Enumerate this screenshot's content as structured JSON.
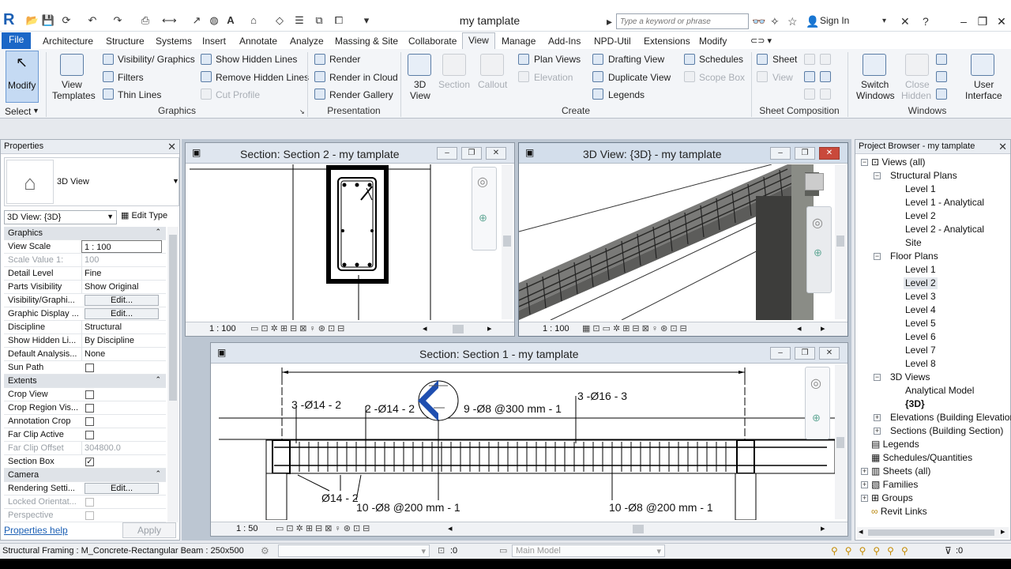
{
  "app": {
    "logo": "R",
    "title": "my tamplate"
  },
  "search": {
    "placeholder": "Type a keyword or phrase"
  },
  "signin": "Sign In",
  "tabs": [
    "File",
    "Architecture",
    "Structure",
    "Systems",
    "Insert",
    "Annotate",
    "Analyze",
    "Massing & Site",
    "Collaborate",
    "View",
    "Manage",
    "Add-Ins",
    "NPD-Util",
    "Extensions",
    "Modify"
  ],
  "ribbon": {
    "modify": "Modify",
    "select": "Select",
    "view_templates": [
      "View",
      "Templates"
    ],
    "graphics_items": [
      "Visibility/ Graphics",
      "Filters",
      "Thin Lines",
      "Show Hidden Lines",
      "Remove Hidden Lines",
      "Cut Profile"
    ],
    "graphics_title": "Graphics",
    "presentation_items": [
      "Render",
      "Render in Cloud",
      "Render Gallery"
    ],
    "presentation_title": "Presentation",
    "create_big": [
      "3D",
      "View",
      "Section",
      "Callout"
    ],
    "create_items": [
      "Plan Views",
      "Elevation",
      "Drafting View",
      "Duplicate View",
      "Legends",
      "Schedules",
      "Scope Box"
    ],
    "create_title": "Create",
    "sheet_items": [
      "Sheet",
      "View"
    ],
    "sheet_title": "Sheet Composition",
    "windows_items": [
      "Switch",
      "Windows",
      "Close",
      "Hidden",
      "User",
      "Interface"
    ],
    "windows_title": "Windows"
  },
  "properties": {
    "title": "Properties",
    "type_name": "3D View",
    "selector": "3D View: {3D}",
    "edit_type": "Edit Type",
    "sections": [
      "Graphics",
      "Extents",
      "Camera"
    ],
    "rows": [
      {
        "k": "View Scale",
        "v": "1 : 100"
      },
      {
        "k": "Scale Value    1:",
        "v": "100"
      },
      {
        "k": "Detail Level",
        "v": "Fine"
      },
      {
        "k": "Parts Visibility",
        "v": "Show Original"
      },
      {
        "k": "Visibility/Graphi...",
        "v": "Edit..."
      },
      {
        "k": "Graphic Display ...",
        "v": "Edit..."
      },
      {
        "k": "Discipline",
        "v": "Structural"
      },
      {
        "k": "Show Hidden Li...",
        "v": "By Discipline"
      },
      {
        "k": "Default Analysis...",
        "v": "None"
      },
      {
        "k": "Sun Path",
        "v": ""
      },
      {
        "k": "Crop View",
        "v": ""
      },
      {
        "k": "Crop Region Vis...",
        "v": ""
      },
      {
        "k": "Annotation Crop",
        "v": ""
      },
      {
        "k": "Far Clip Active",
        "v": ""
      },
      {
        "k": "Far Clip Offset",
        "v": "304800.0"
      },
      {
        "k": "Section Box",
        "v": "✓"
      },
      {
        "k": "Rendering Setti...",
        "v": "Edit..."
      },
      {
        "k": "Locked Orientat...",
        "v": ""
      },
      {
        "k": "Perspective",
        "v": ""
      }
    ],
    "help": "Properties help",
    "apply": "Apply"
  },
  "views": {
    "section2": {
      "title": "Section: Section 2 - my tamplate",
      "scale": "1 : 100"
    },
    "view3d": {
      "title": "3D View: {3D} - my tamplate",
      "scale": "1 : 100"
    },
    "section1": {
      "title": "Section: Section 1 - my tamplate",
      "scale": "1 : 50",
      "annotations": [
        "3 -Ø14 - 2",
        "2 -Ø14 - 2",
        "9 -Ø8 @300 mm - 1",
        "3 -Ø16 - 3",
        "Ø14 - 2",
        "10 -Ø8 @200 mm - 1",
        "10 -Ø8 @200 mm - 1"
      ]
    }
  },
  "browser": {
    "title": "Project Browser - my tamplate",
    "nodes": [
      "Views (all)",
      "Structural Plans",
      "Level 1",
      "Level 1 - Analytical",
      "Level 2",
      "Level 2 - Analytical",
      "Site",
      "Floor Plans",
      "Level 1",
      "Level 2",
      "Level 3",
      "Level 4",
      "Level 5",
      "Level 6",
      "Level 7",
      "Level 8",
      "3D Views",
      "Analytical Model",
      "{3D}",
      "Elevations (Building Elevation",
      "Sections (Building Section)",
      "Legends",
      "Schedules/Quantities",
      "Sheets (all)",
      "Families",
      "Groups",
      "Revit Links"
    ]
  },
  "status": {
    "text": "Structural Framing : M_Concrete-Rectangular Beam : 250x500",
    "zero": ":0",
    "model": "Main Model",
    "filter": ":0"
  }
}
